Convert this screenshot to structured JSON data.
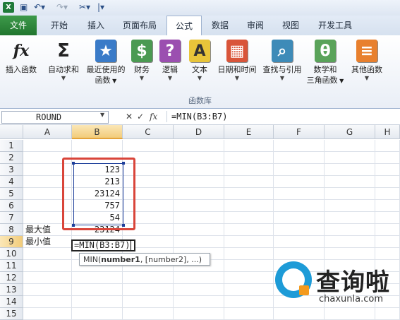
{
  "quick_access": {
    "icons": [
      "excel-icon",
      "save-icon",
      "undo-icon",
      "redo-icon",
      "tools-icon"
    ]
  },
  "tabs": [
    "文件",
    "开始",
    "插入",
    "页面布局",
    "公式",
    "数据",
    "审阅",
    "视图",
    "开发工具"
  ],
  "active_tab": "公式",
  "ribbon": {
    "buttons": [
      {
        "label": "插入函数",
        "icon": "fx"
      },
      {
        "label": "自动求和",
        "icon": "Σ"
      },
      {
        "label": "最近使用的",
        "label2": "函数",
        "icon": "★"
      },
      {
        "label": "财务",
        "icon": "$"
      },
      {
        "label": "逻辑",
        "icon": "?"
      },
      {
        "label": "文本",
        "icon": "A"
      },
      {
        "label": "日期和时间",
        "icon": "▦"
      },
      {
        "label": "查找与引用",
        "icon": "⌕"
      },
      {
        "label": "数学和",
        "label2": "三角函数",
        "icon": "θ"
      },
      {
        "label": "其他函数",
        "icon": "≡"
      }
    ],
    "group_label": "函数库"
  },
  "formula_bar": {
    "name_box": "ROUND",
    "cancel": "✕",
    "enter": "✓",
    "fx": "fx",
    "formula": "=MIN(B3:B7)"
  },
  "columns": [
    "A",
    "B",
    "C",
    "D",
    "E",
    "F",
    "G",
    "H"
  ],
  "rows": [
    "1",
    "2",
    "3",
    "4",
    "5",
    "6",
    "7",
    "8",
    "9",
    "10",
    "11",
    "12",
    "13",
    "14",
    "15"
  ],
  "cells": {
    "B3": "123",
    "B4": "213",
    "B5": "23124",
    "B6": "757",
    "B7": "54",
    "A8": "最大值",
    "B8": "23124",
    "A9": "最小值"
  },
  "edit_cell": "=MIN(B3:B7)",
  "tooltip": {
    "fn": "MIN(",
    "arg1": "number1",
    "rest": ", [number2], ...)"
  },
  "watermark": {
    "cn": "查询啦",
    "en": "chaxunla.com"
  },
  "colors": {
    "file_tab": "#2b8a3e",
    "selection": "#1d3e9a",
    "highlight_box": "#d9453a",
    "logo_blue": "#1d9bd7"
  }
}
